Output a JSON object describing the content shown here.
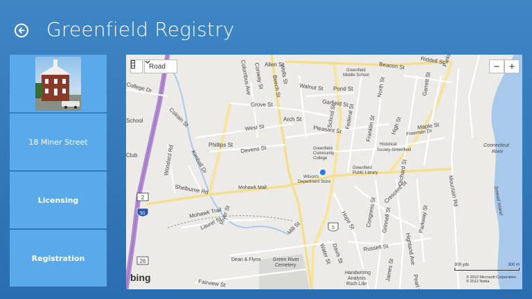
{
  "header": {
    "title": "Greenfield Registry"
  },
  "sidebar": {
    "items": [
      {
        "label": ""
      },
      {
        "label": "18 Miner Street"
      },
      {
        "label": "Licensing"
      },
      {
        "label": "Registration"
      }
    ]
  },
  "map": {
    "style_select": "Road",
    "zoom_out": "−",
    "zoom_in": "+",
    "logo": "bing",
    "scale": {
      "left": "300 yds",
      "right": "300 m"
    },
    "copyright": [
      "© 2012 Microsoft Corporation",
      "© 2012 Nokia"
    ],
    "labels": [
      "Allen St",
      "Beacon St",
      "Riddell St",
      "Parkway",
      "Greenfield",
      "Middle School",
      "Columbus Ave",
      "Conway St",
      "Wells St",
      "Beech St",
      "Walnut St",
      "Pond St",
      "North St",
      "Garrett St",
      "College Dr",
      "Grove St",
      "Garfield St",
      "School St",
      "Federal St",
      "Colrain St",
      "Arch St",
      "Pleasant St",
      "Maple St",
      "Freeman Dr",
      "West St",
      "Phillips St",
      "Devens St",
      "Franklin St",
      "Historical",
      "Society-Greenfield",
      "High St",
      "Connecticut",
      "River",
      "Woodard Rd",
      "Kimball Dr",
      "Greenfield",
      "Community",
      "College",
      "Greenfield",
      "Public Library",
      "Orchard St",
      "Mountain Rd",
      "Wilson's",
      "Department Store",
      "Shelburne Rd",
      "Mohawk Mall",
      "Crescent St",
      "Smead Island",
      "Mohawk Trail",
      "Laurel St",
      "River St",
      "Mill St",
      "Hope St",
      "Congress St",
      "Grinnell St",
      "Parkway St",
      "Russell St",
      "Highland Ave",
      "Dean & Flynn",
      "Green River",
      "Cemetery",
      "Davis St",
      "Water St",
      "James St",
      "Handwriting",
      "Analysis",
      "Rsch Libr",
      "Fairview St",
      "Pearl St",
      "School",
      "Club"
    ],
    "shields": [
      "2",
      "91",
      "5",
      "26"
    ]
  }
}
